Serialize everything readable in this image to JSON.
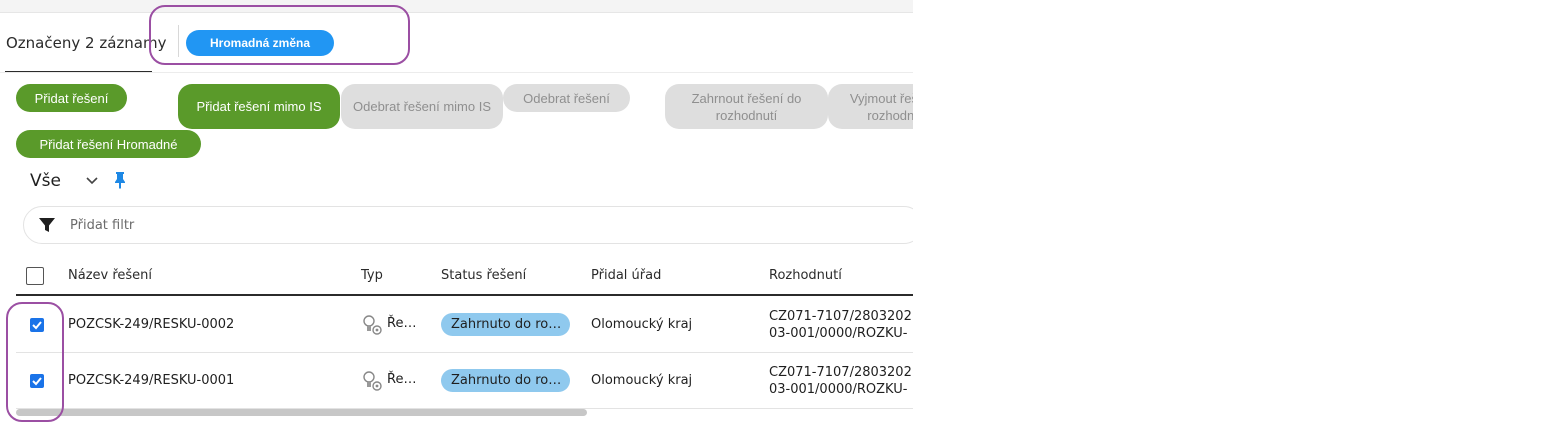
{
  "selection": {
    "count_label": "Označeny 2 záznamy",
    "bulk_button": "Hromadná změna"
  },
  "actions": {
    "add_solution": "Přidat řešení",
    "add_solution_outside_is": "Přidat řešení mimo IS",
    "remove_solution_outside_is": "Odebrat řešení mimo IS",
    "remove_solution": "Odebrat řešení",
    "include_in_decision": "Zahrnout řešení do rozhodnutí",
    "exclude_from_decision": "Vyjmout řešení z rozhodnutí",
    "add_solution_bulk": "Přidat řešení Hromadné"
  },
  "view": {
    "selected": "Vše"
  },
  "filter": {
    "placeholder": "Přidat filtr"
  },
  "table": {
    "columns": [
      "Název řešení",
      "Typ",
      "Status řešení",
      "Přidal úřad",
      "Rozhodnutí"
    ],
    "rows": [
      {
        "name": "POZCSK-249/RESKU-0002",
        "type": "Ře…",
        "status": "Zahrnuto do ro…",
        "office": "Olomoucký kraj",
        "decision_line1": "CZ071-7107/2803202",
        "decision_line2": "03-001/0000/ROZKU-",
        "checked": true
      },
      {
        "name": "POZCSK-249/RESKU-0001",
        "type": "Ře…",
        "status": "Zahrnuto do ro…",
        "office": "Olomoucký kraj",
        "decision_line1": "CZ071-7107/2803202",
        "decision_line2": "03-001/0000/ROZKU-",
        "checked": true
      }
    ]
  },
  "colors": {
    "primary_blue": "#2196f3",
    "action_green": "#5a9a2a",
    "disabled_grey": "#dedede",
    "status_blue": "#8fc9ee",
    "highlight_purple": "#9b4fa3",
    "checkbox_blue": "#1a73e8"
  },
  "icons": {
    "view_dropdown": "chevron-down-icon",
    "pin": "pin-icon",
    "filter": "filter-icon",
    "type": "solution-type-icon",
    "checkbox": "check-icon"
  }
}
